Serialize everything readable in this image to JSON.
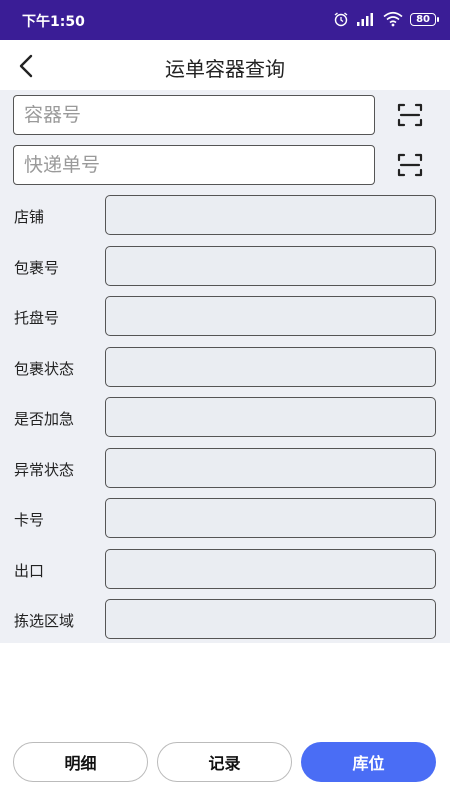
{
  "status_bar": {
    "time": "下午1:50",
    "battery": "80"
  },
  "header": {
    "title": "运单容器查询"
  },
  "search": {
    "container_placeholder": "容器号",
    "express_placeholder": "快递单号"
  },
  "fields": [
    {
      "label": "店铺",
      "value": ""
    },
    {
      "label": "包裹号",
      "value": ""
    },
    {
      "label": "托盘号",
      "value": ""
    },
    {
      "label": "包裹状态",
      "value": ""
    },
    {
      "label": "是否加急",
      "value": ""
    },
    {
      "label": "异常状态",
      "value": ""
    },
    {
      "label": "卡号",
      "value": ""
    },
    {
      "label": "出口",
      "value": ""
    },
    {
      "label": "拣选区域",
      "value": ""
    }
  ],
  "buttons": {
    "detail": "明细",
    "record": "记录",
    "location": "库位"
  },
  "colors": {
    "status_bar": "#3a1d96",
    "primary": "#4a6df5",
    "content_bg": "#eef0f5"
  },
  "icons": [
    "alarm-icon",
    "signal-icon",
    "wifi-icon",
    "battery-icon",
    "back-arrow-icon",
    "scan-icon"
  ]
}
